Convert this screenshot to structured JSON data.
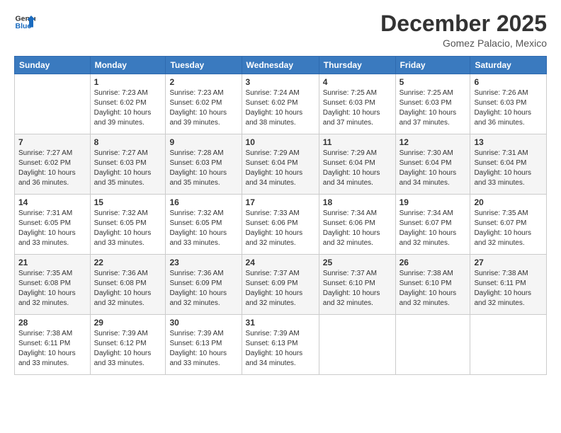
{
  "header": {
    "logo_line1": "General",
    "logo_line2": "Blue",
    "main_title": "December 2025",
    "subtitle": "Gomez Palacio, Mexico"
  },
  "days_of_week": [
    "Sunday",
    "Monday",
    "Tuesday",
    "Wednesday",
    "Thursday",
    "Friday",
    "Saturday"
  ],
  "weeks": [
    [
      {
        "day": "",
        "info": ""
      },
      {
        "day": "1",
        "info": "Sunrise: 7:23 AM\nSunset: 6:02 PM\nDaylight: 10 hours and 39 minutes."
      },
      {
        "day": "2",
        "info": "Sunrise: 7:23 AM\nSunset: 6:02 PM\nDaylight: 10 hours and 39 minutes."
      },
      {
        "day": "3",
        "info": "Sunrise: 7:24 AM\nSunset: 6:02 PM\nDaylight: 10 hours and 38 minutes."
      },
      {
        "day": "4",
        "info": "Sunrise: 7:25 AM\nSunset: 6:03 PM\nDaylight: 10 hours and 37 minutes."
      },
      {
        "day": "5",
        "info": "Sunrise: 7:25 AM\nSunset: 6:03 PM\nDaylight: 10 hours and 37 minutes."
      },
      {
        "day": "6",
        "info": "Sunrise: 7:26 AM\nSunset: 6:03 PM\nDaylight: 10 hours and 36 minutes."
      }
    ],
    [
      {
        "day": "7",
        "info": "Sunrise: 7:27 AM\nSunset: 6:02 PM\nDaylight: 10 hours and 36 minutes."
      },
      {
        "day": "8",
        "info": "Sunrise: 7:27 AM\nSunset: 6:03 PM\nDaylight: 10 hours and 35 minutes."
      },
      {
        "day": "9",
        "info": "Sunrise: 7:28 AM\nSunset: 6:03 PM\nDaylight: 10 hours and 35 minutes."
      },
      {
        "day": "10",
        "info": "Sunrise: 7:29 AM\nSunset: 6:04 PM\nDaylight: 10 hours and 34 minutes."
      },
      {
        "day": "11",
        "info": "Sunrise: 7:29 AM\nSunset: 6:04 PM\nDaylight: 10 hours and 34 minutes."
      },
      {
        "day": "12",
        "info": "Sunrise: 7:30 AM\nSunset: 6:04 PM\nDaylight: 10 hours and 34 minutes."
      },
      {
        "day": "13",
        "info": "Sunrise: 7:31 AM\nSunset: 6:04 PM\nDaylight: 10 hours and 33 minutes."
      }
    ],
    [
      {
        "day": "14",
        "info": "Sunrise: 7:31 AM\nSunset: 6:05 PM\nDaylight: 10 hours and 33 minutes."
      },
      {
        "day": "15",
        "info": "Sunrise: 7:32 AM\nSunset: 6:05 PM\nDaylight: 10 hours and 33 minutes."
      },
      {
        "day": "16",
        "info": "Sunrise: 7:32 AM\nSunset: 6:05 PM\nDaylight: 10 hours and 33 minutes."
      },
      {
        "day": "17",
        "info": "Sunrise: 7:33 AM\nSunset: 6:06 PM\nDaylight: 10 hours and 32 minutes."
      },
      {
        "day": "18",
        "info": "Sunrise: 7:34 AM\nSunset: 6:06 PM\nDaylight: 10 hours and 32 minutes."
      },
      {
        "day": "19",
        "info": "Sunrise: 7:34 AM\nSunset: 6:07 PM\nDaylight: 10 hours and 32 minutes."
      },
      {
        "day": "20",
        "info": "Sunrise: 7:35 AM\nSunset: 6:07 PM\nDaylight: 10 hours and 32 minutes."
      }
    ],
    [
      {
        "day": "21",
        "info": "Sunrise: 7:35 AM\nSunset: 6:08 PM\nDaylight: 10 hours and 32 minutes."
      },
      {
        "day": "22",
        "info": "Sunrise: 7:36 AM\nSunset: 6:08 PM\nDaylight: 10 hours and 32 minutes."
      },
      {
        "day": "23",
        "info": "Sunrise: 7:36 AM\nSunset: 6:09 PM\nDaylight: 10 hours and 32 minutes."
      },
      {
        "day": "24",
        "info": "Sunrise: 7:37 AM\nSunset: 6:09 PM\nDaylight: 10 hours and 32 minutes."
      },
      {
        "day": "25",
        "info": "Sunrise: 7:37 AM\nSunset: 6:10 PM\nDaylight: 10 hours and 32 minutes."
      },
      {
        "day": "26",
        "info": "Sunrise: 7:38 AM\nSunset: 6:10 PM\nDaylight: 10 hours and 32 minutes."
      },
      {
        "day": "27",
        "info": "Sunrise: 7:38 AM\nSunset: 6:11 PM\nDaylight: 10 hours and 32 minutes."
      }
    ],
    [
      {
        "day": "28",
        "info": "Sunrise: 7:38 AM\nSunset: 6:11 PM\nDaylight: 10 hours and 33 minutes."
      },
      {
        "day": "29",
        "info": "Sunrise: 7:39 AM\nSunset: 6:12 PM\nDaylight: 10 hours and 33 minutes."
      },
      {
        "day": "30",
        "info": "Sunrise: 7:39 AM\nSunset: 6:13 PM\nDaylight: 10 hours and 33 minutes."
      },
      {
        "day": "31",
        "info": "Sunrise: 7:39 AM\nSunset: 6:13 PM\nDaylight: 10 hours and 34 minutes."
      },
      {
        "day": "",
        "info": ""
      },
      {
        "day": "",
        "info": ""
      },
      {
        "day": "",
        "info": ""
      }
    ]
  ]
}
